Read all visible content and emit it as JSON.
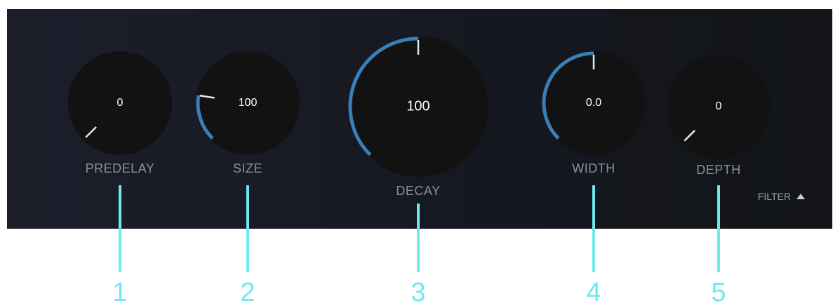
{
  "knobs": [
    {
      "id": "predelay",
      "label": "PREDELAY",
      "value": "0",
      "level": 0.0
    },
    {
      "id": "size",
      "label": "SIZE",
      "value": "100",
      "level": 0.2
    },
    {
      "id": "decay",
      "label": "DECAY",
      "value": "100",
      "level": 0.5
    },
    {
      "id": "width",
      "label": "WIDTH",
      "value": "0.0",
      "level": 0.5
    },
    {
      "id": "depth",
      "label": "DEPTH",
      "value": "0",
      "level": 0.0
    }
  ],
  "filter": {
    "label": "FILTER",
    "icon": "triangle-up-icon"
  },
  "callouts": [
    "1",
    "2",
    "3",
    "4",
    "5"
  ],
  "colors": {
    "panel_bg": "#1a1d27",
    "knob_bg": "#121212",
    "arc": "#3a7fb8",
    "pointer": "#e6e6e6",
    "label": "#8a8f9a",
    "callout": "#6fe9f0"
  }
}
